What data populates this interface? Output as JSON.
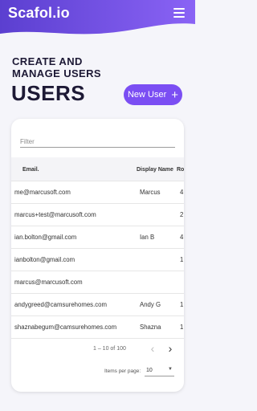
{
  "app": {
    "logo": "Scafol.io",
    "menu_icon": "hamburger-icon",
    "brand_color_start": "#5b3fd0",
    "brand_color_end": "#8a63f5"
  },
  "page": {
    "subtitle_line1": "CREATE AND",
    "subtitle_line2": "MANAGE USERS",
    "title": "USERS",
    "new_user_label": "New User",
    "new_user_icon": "plus-icon",
    "accent_color": "#7b4ef3"
  },
  "table": {
    "filter_placeholder": "Filter",
    "columns": {
      "email": "Email.",
      "display_name": "Display Name",
      "role": "Ro"
    },
    "rows": [
      {
        "email": "me@marcusoft.com",
        "display_name": "Marcus",
        "role": "4"
      },
      {
        "email": "marcus+test@marcusoft.com",
        "display_name": "",
        "role": "2"
      },
      {
        "email": "ian.bolton@gmail.com",
        "display_name": "Ian B",
        "role": "4"
      },
      {
        "email": "ianbolton@gmail.com",
        "display_name": "",
        "role": "1"
      },
      {
        "email": "marcus@marcusoft.com",
        "display_name": "",
        "role": ""
      },
      {
        "email": "andygreed@camsurehomes.com",
        "display_name": "Andy G",
        "role": "1"
      },
      {
        "email": "shaznabegum@camsurehomes.com",
        "display_name": "Shazna",
        "role": "1"
      }
    ]
  },
  "pagination": {
    "range_text": "1 – 10 of 100",
    "items_per_page_label": "Items per page:",
    "items_per_page_value": "10",
    "prev_icon": "chevron-left-icon",
    "next_icon": "chevron-right-icon"
  }
}
